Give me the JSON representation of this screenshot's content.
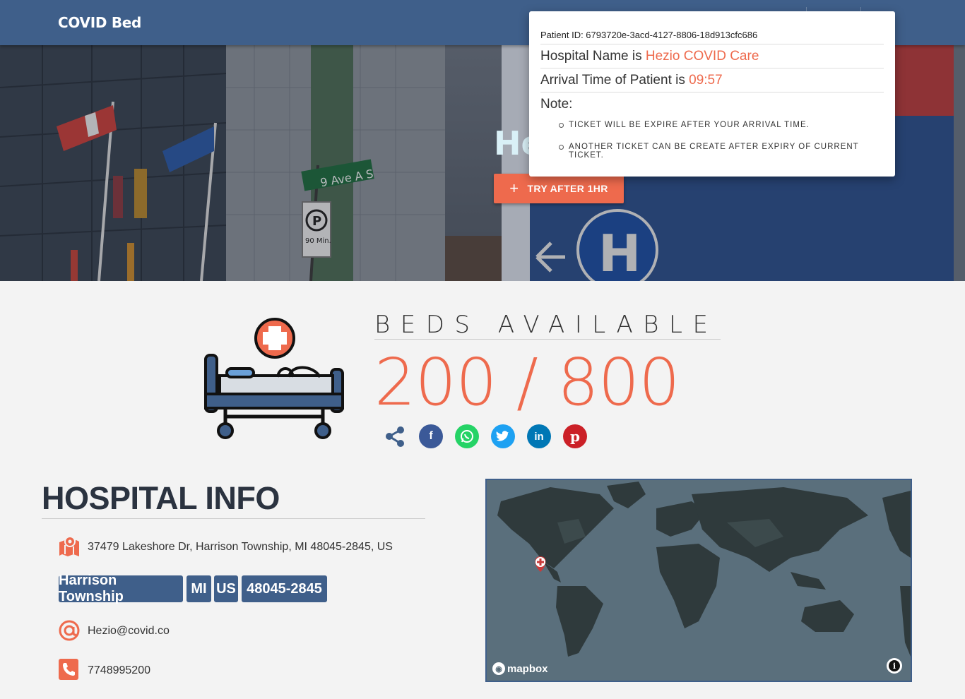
{
  "navbar": {
    "brand": "COVID Bed"
  },
  "hero": {
    "title": "He",
    "button_label": "TRY AFTER 1HR",
    "street_sign": "9 Ave A S",
    "parking_sign": "90 Min."
  },
  "popup": {
    "patient_id_label": "Patient ID: 6793720e-3acd-4127-8806-18d913cfc686",
    "hospital_prefix": "Hospital Name is",
    "hospital_name": "Hezio COVID Care",
    "arrival_prefix": "Arrival Time of Patient is",
    "arrival_time": "09:57",
    "note_label": "Note:",
    "notes": [
      "TICKET WILL BE EXPIRE AFTER YOUR ARRIVAL TIME.",
      "ANOTHER TICKET CAN BE CREATE AFTER EXPIRY OF CURRENT TICKET."
    ]
  },
  "beds": {
    "label": "BEDS AVAILABLE:",
    "count": "200 / 800"
  },
  "share": {
    "icons": [
      "share-icon",
      "facebook-icon",
      "whatsapp-icon",
      "twitter-icon",
      "linkedin-icon",
      "pinterest-icon"
    ],
    "colors": {
      "facebook": "#3b5998",
      "whatsapp": "#25d366",
      "twitter": "#1da1f2",
      "linkedin": "#0077b5",
      "pinterest": "#cb2027"
    }
  },
  "info": {
    "title": "HOSPITAL INFO",
    "address": "37479 Lakeshore Dr, Harrison Township, MI 48045-2845, US",
    "tags": [
      "Harrison Township",
      "MI",
      "US",
      "48045-2845"
    ],
    "email": "Hezio@covid.co",
    "phone": "7748995200"
  },
  "map": {
    "attribution": "mapbox"
  },
  "colors": {
    "primary": "#3f5f8a",
    "accent": "#ee6a4d"
  }
}
